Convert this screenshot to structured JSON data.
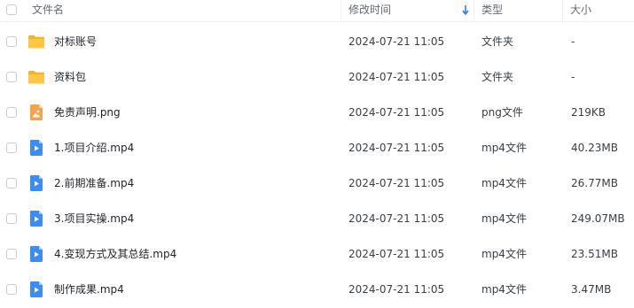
{
  "columns": {
    "name": "文件名",
    "modified": "修改时间",
    "type": "类型",
    "size": "大小"
  },
  "sort": {
    "column": "modified",
    "direction": "descending",
    "icon": "sort-arrow-down-icon",
    "color": "#2a7cf7"
  },
  "colors": {
    "folder": "#f9c43c",
    "image_file": "#f5a24b",
    "video_file": "#3d8ef5"
  },
  "files": [
    {
      "icon": "folder-icon",
      "name": "对标账号",
      "modified": "2024-07-21 11:05",
      "type": "文件夹",
      "size": "-"
    },
    {
      "icon": "folder-icon",
      "name": "资料包",
      "modified": "2024-07-21 11:05",
      "type": "文件夹",
      "size": "-"
    },
    {
      "icon": "image-file-icon",
      "name": "免责声明.png",
      "modified": "2024-07-21 11:05",
      "type": "png文件",
      "size": "219KB"
    },
    {
      "icon": "video-file-icon",
      "name": "1.项目介绍.mp4",
      "modified": "2024-07-21 11:05",
      "type": "mp4文件",
      "size": "40.23MB"
    },
    {
      "icon": "video-file-icon",
      "name": "2.前期准备.mp4",
      "modified": "2024-07-21 11:05",
      "type": "mp4文件",
      "size": "26.77MB"
    },
    {
      "icon": "video-file-icon",
      "name": "3.项目实操.mp4",
      "modified": "2024-07-21 11:05",
      "type": "mp4文件",
      "size": "249.07MB"
    },
    {
      "icon": "video-file-icon",
      "name": "4.变现方式及其总结.mp4",
      "modified": "2024-07-21 11:05",
      "type": "mp4文件",
      "size": "23.51MB"
    },
    {
      "icon": "video-file-icon",
      "name": "制作成果.mp4",
      "modified": "2024-07-21 11:05",
      "type": "mp4文件",
      "size": "3.47MB"
    }
  ]
}
